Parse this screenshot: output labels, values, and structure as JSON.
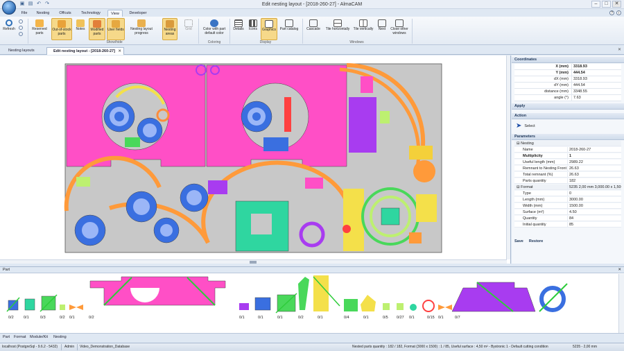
{
  "window": {
    "title": "Edit nesting layout - [2018-260-27] - AlmaCAM"
  },
  "menu": [
    "File",
    "Nesting",
    "Offcuts",
    "Technology",
    "View",
    "Developer"
  ],
  "ribbon": {
    "buttons": [
      {
        "label": "Refresh"
      },
      {
        "label": "Reserved parts"
      },
      {
        "label": "Out-of-stock parts"
      },
      {
        "label": "Notes"
      },
      {
        "label": "Modified parts"
      },
      {
        "label": "User fields"
      },
      {
        "label": "Nesting layout progress"
      },
      {
        "label": "Nesting areas"
      },
      {
        "label": "Grid"
      },
      {
        "label": "Color with part default color"
      },
      {
        "label": "Details"
      },
      {
        "label": "Icons"
      },
      {
        "label": "Graphics"
      },
      {
        "label": "Part catalog"
      },
      {
        "label": "Cascade"
      },
      {
        "label": "Tile horizontally"
      },
      {
        "label": "Tile vertically"
      },
      {
        "label": "Next"
      },
      {
        "label": "Close other windows"
      }
    ],
    "groups": [
      "Show/hide",
      "Coloring",
      "Display",
      "Windows"
    ]
  },
  "doc_tabs": [
    "Nesting layouts",
    "Edit nesting layout - [2018-260-27]"
  ],
  "coordinates": {
    "title": "Coordinates",
    "rows": [
      {
        "k": "X (mm)",
        "v": "3318.93"
      },
      {
        "k": "Y (mm)",
        "v": "444.54"
      },
      {
        "k": "dX (mm)",
        "v": "3318.93"
      },
      {
        "k": "dY (mm)",
        "v": "444.54"
      },
      {
        "k": "distance (mm)",
        "v": "3348.55"
      },
      {
        "k": "angle (°)",
        "v": "7.63"
      }
    ]
  },
  "apply": {
    "title": "Apply"
  },
  "action": {
    "title": "Action",
    "select": "Select"
  },
  "parameters": {
    "title": "Parameters",
    "rows": [
      {
        "k": "Nesting",
        "v": "",
        "grp": true
      },
      {
        "k": "Name",
        "v": "2018-260-27"
      },
      {
        "k": "Multiplicity",
        "v": "1",
        "bold": true
      },
      {
        "k": "Useful length (mm)",
        "v": "2989.22"
      },
      {
        "k": "Remnant to Nesting Front",
        "v": "26.63"
      },
      {
        "k": "Total remnant (%)",
        "v": "26.63"
      },
      {
        "k": "Parts quantity",
        "v": "182"
      },
      {
        "k": "Format",
        "v": "5235 2,00 mm 3,000.00 x 1,500.0",
        "grp": true
      },
      {
        "k": "Type",
        "v": "0"
      },
      {
        "k": "Length (mm)",
        "v": "3000.00"
      },
      {
        "k": "Width (mm)",
        "v": "1500.00"
      },
      {
        "k": "Surface (m²)",
        "v": "4.50"
      },
      {
        "k": "Quantity",
        "v": "84"
      },
      {
        "k": "Initial quantity",
        "v": "85"
      }
    ],
    "save": "Save",
    "restore": "Restore"
  },
  "part_panel": {
    "title": "Part",
    "quantities": [
      "0/2",
      "0/1",
      "0/3",
      "0/2",
      "0/1",
      "0/2",
      "0/1",
      "0/1",
      "0/1",
      "0/2",
      "0/1",
      "0/4",
      "0/1",
      "0/5",
      "0/27",
      "0/1",
      "0/15",
      "0/1",
      "0/7"
    ]
  },
  "bottom_tabs": [
    "Part",
    "Format",
    "Module/Kit",
    "Nesting"
  ],
  "status": {
    "server": "localhost (PostgreSql - 9.6.2 - 5432)",
    "user": "Admin",
    "db": "Video_Demonstration_Database",
    "summary": "Nested parts quantity : 182 / 182, Format (3000 x 1500) : 1 / 85, Useful surface : 4,50 m² - Bystronic 1 - Default cutting condition",
    "format": "5235 - 2,00 mm"
  }
}
